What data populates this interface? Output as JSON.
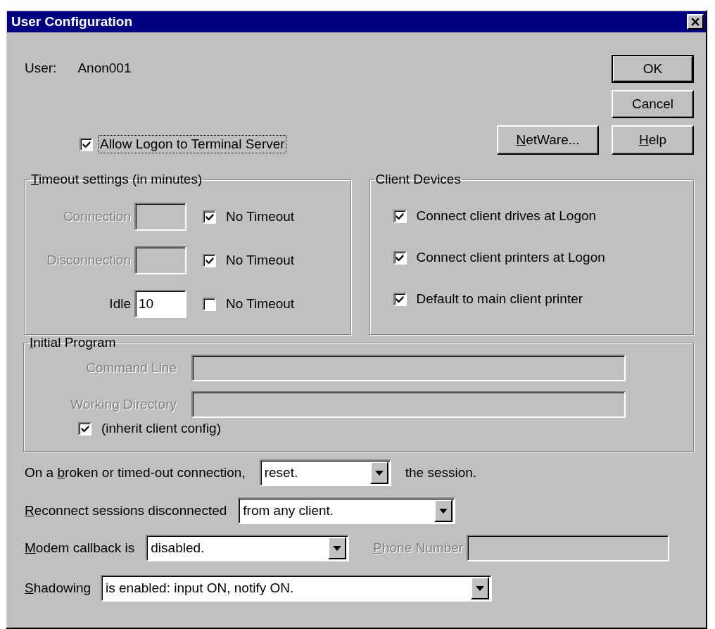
{
  "window": {
    "title": "User Configuration"
  },
  "user": {
    "label": "User:",
    "value": "Anon001"
  },
  "buttons": [
    {
      "label": "OK",
      "default": true
    },
    {
      "label": "Cancel",
      "default": false
    },
    {
      "label": {
        "key": "N",
        "after": "etWare..."
      },
      "default": false
    },
    {
      "label": {
        "key": "H",
        "after": "elp"
      },
      "default": false
    }
  ],
  "allow_logon": {
    "label": "Allow Logon to Terminal Server",
    "checked": true,
    "focused": true
  },
  "timeout_settings": {
    "title": {
      "key": "T",
      "after": "imeout settings (in minutes)"
    },
    "rows": [
      {
        "label": "Connection",
        "disabled": true,
        "no_timeout": {
          "label": "No Timeout",
          "checked": true
        }
      },
      {
        "label": "Disconnection",
        "disabled": true,
        "no_timeout": {
          "label": "No Timeout",
          "checked": true
        }
      },
      {
        "label": "Idle",
        "value": "10",
        "disabled": false,
        "no_timeout": {
          "label": "No Timeout",
          "checked": false
        }
      }
    ]
  },
  "client_devices": {
    "title": "Client Devices",
    "options": [
      {
        "label": "Connect client drives at Logon",
        "checked": true
      },
      {
        "label": "Connect client printers at Logon",
        "checked": true
      },
      {
        "label": "Default to main client printer",
        "checked": true
      }
    ]
  },
  "initial_program": {
    "title": {
      "key": "I",
      "after": "nitial Program"
    },
    "fields": [
      {
        "label": "Command Line",
        "disabled": true
      },
      {
        "label": "Working Directory",
        "disabled": true
      }
    ],
    "inherit": {
      "label": "(inherit client config)",
      "checked": true
    }
  },
  "broken_connection": {
    "label": {
      "before": "On a ",
      "key": "b",
      "after": "roken or timed-out connection,"
    },
    "value": "reset.",
    "suffix": "the session."
  },
  "reconnect": {
    "label": {
      "key": "R",
      "after": "econnect sessions disconnected"
    },
    "value": "from any client."
  },
  "modem_callback": {
    "label": {
      "key": "M",
      "after": "odem callback is"
    },
    "value": "disabled.",
    "phone": {
      "label": {
        "key": "P",
        "after": "hone Number"
      },
      "disabled": true
    }
  },
  "shadowing": {
    "label": {
      "key": "S",
      "after": "hadowing"
    },
    "value": "is enabled: input ON, notify ON."
  }
}
